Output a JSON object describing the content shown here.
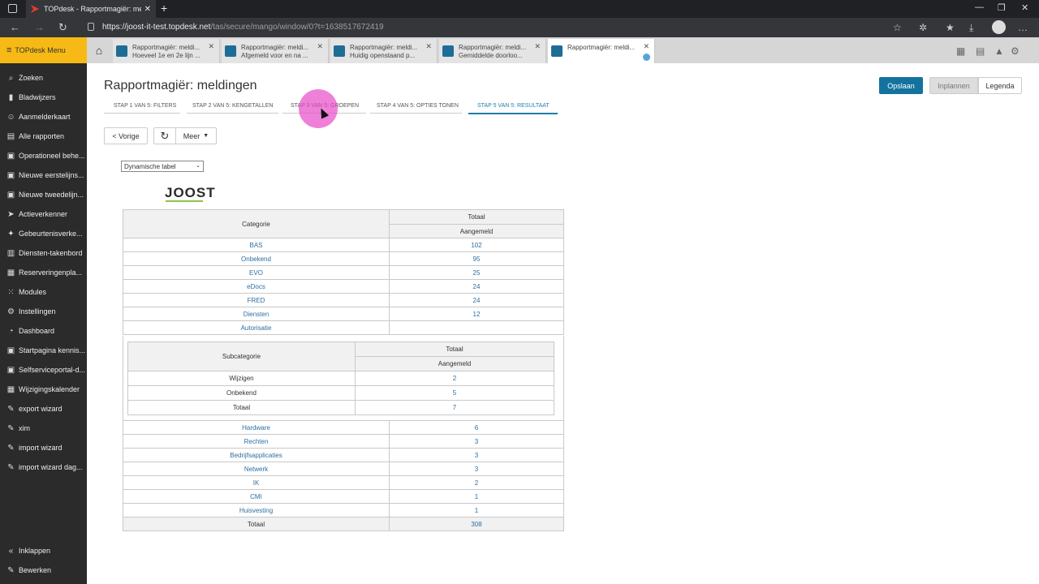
{
  "browser": {
    "tab_title": "TOPdesk - Rapportmagiër: meld",
    "tab_close": "✕",
    "new_tab": "+",
    "url_host": "https://joost-it-test.topdesk.net",
    "url_path": "/tas/secure/mango/window/0?t=1638517672419",
    "controls": [
      "—",
      "❐",
      "✕"
    ]
  },
  "sidebar": {
    "menu_label": "TOPdesk Menu",
    "items": [
      {
        "label": "Zoeken",
        "icon": "search-icon"
      },
      {
        "label": "Bladwijzers",
        "icon": "bookmark-icon"
      },
      {
        "label": "Aanmelderkaart",
        "icon": "person-icon"
      },
      {
        "label": "Alle rapporten",
        "icon": "report-icon"
      },
      {
        "label": "Operationeel behe...",
        "icon": "module-icon"
      },
      {
        "label": "Nieuwe eerstelijns...",
        "icon": "module-icon"
      },
      {
        "label": "Nieuwe tweedelijn...",
        "icon": "module-icon"
      },
      {
        "label": "Actieverkenner",
        "icon": "action-icon"
      },
      {
        "label": "Gebeurtenisverke...",
        "icon": "event-icon"
      },
      {
        "label": "Diensten-takenbord",
        "icon": "board-icon"
      },
      {
        "label": "Reserveringenpla...",
        "icon": "calendar-icon"
      },
      {
        "label": "Modules",
        "icon": "grid-icon"
      },
      {
        "label": "Instellingen",
        "icon": "settings-icon"
      },
      {
        "label": "Dashboard",
        "icon": "dashboard-icon"
      },
      {
        "label": "Startpagina kennis...",
        "icon": "module-icon"
      },
      {
        "label": "Selfserviceportal-d...",
        "icon": "module-icon"
      },
      {
        "label": "Wijzigingskalender",
        "icon": "calendar-icon"
      },
      {
        "label": "export wizard",
        "icon": "wizard-icon"
      },
      {
        "label": "xim",
        "icon": "wizard-icon"
      },
      {
        "label": "import wizard",
        "icon": "wizard-icon"
      },
      {
        "label": "import wizard dag...",
        "icon": "wizard-icon"
      }
    ],
    "bottom": [
      {
        "label": "Inklappen",
        "icon": "collapse-icon"
      },
      {
        "label": "Bewerken",
        "icon": "edit-icon"
      }
    ]
  },
  "app_tabs": [
    {
      "line1": "Rapportmagiër: meldi...",
      "line2": "Hoeveel 1e en 2e lijn ..."
    },
    {
      "line1": "Rapportmagiër: meldi...",
      "line2": "Afgemeld voor en na ..."
    },
    {
      "line1": "Rapportmagiër: meldi...",
      "line2": "Huidig openstaand p..."
    },
    {
      "line1": "Rapportmagiër: meldi...",
      "line2": "Gemiddelde doorloo..."
    },
    {
      "line1": "Rapportmagiër: meldi...",
      "line2": ""
    }
  ],
  "page": {
    "title": "Rapportmagiër: meldingen",
    "save": "Opslaan",
    "schedule": "Inplannen",
    "legend": "Legenda",
    "prev": "< Vorige",
    "more": "Meer",
    "steps": [
      "STAP 1 VAN 5: FILTERS",
      "STAP 2 VAN 5: KENGETALLEN",
      "STAP 3 VAN 5: GROEPEN",
      "STAP 4 VAN 5: OPTIES TONEN",
      "STAP 5 VAN 5: RESULTAAT"
    ],
    "active_step": 4,
    "view_select": "Dynamische tabel",
    "logo": "JOOST"
  },
  "table": {
    "col_category": "Categorie",
    "col_total": "Totaal",
    "col_reported": "Aangemeld",
    "rows_top": [
      {
        "name": "BAS",
        "value": "102"
      },
      {
        "name": "Onbekend",
        "value": "95"
      },
      {
        "name": "EVO",
        "value": "25"
      },
      {
        "name": "eDocs",
        "value": "24"
      },
      {
        "name": "FRED",
        "value": "24"
      },
      {
        "name": "Diensten",
        "value": "12"
      },
      {
        "name": "Autorisatie",
        "value": ""
      }
    ],
    "sub": {
      "col_subcategory": "Subcategorie",
      "col_total": "Totaal",
      "col_reported": "Aangemeld",
      "rows": [
        {
          "name": "Wijzigen",
          "value": "2"
        },
        {
          "name": "Onbekend",
          "value": "5"
        }
      ],
      "total_label": "Totaal",
      "total_value": "7"
    },
    "rows_bottom": [
      {
        "name": "Hardware",
        "value": "6"
      },
      {
        "name": "Rechten",
        "value": "3"
      },
      {
        "name": "Bedrijfsapplicaties",
        "value": "3"
      },
      {
        "name": "Netwerk",
        "value": "3"
      },
      {
        "name": "IK",
        "value": "2"
      },
      {
        "name": "CMI",
        "value": "1"
      },
      {
        "name": "Huisvesting",
        "value": "1"
      }
    ],
    "total_label": "Totaal",
    "total_value": "308"
  }
}
